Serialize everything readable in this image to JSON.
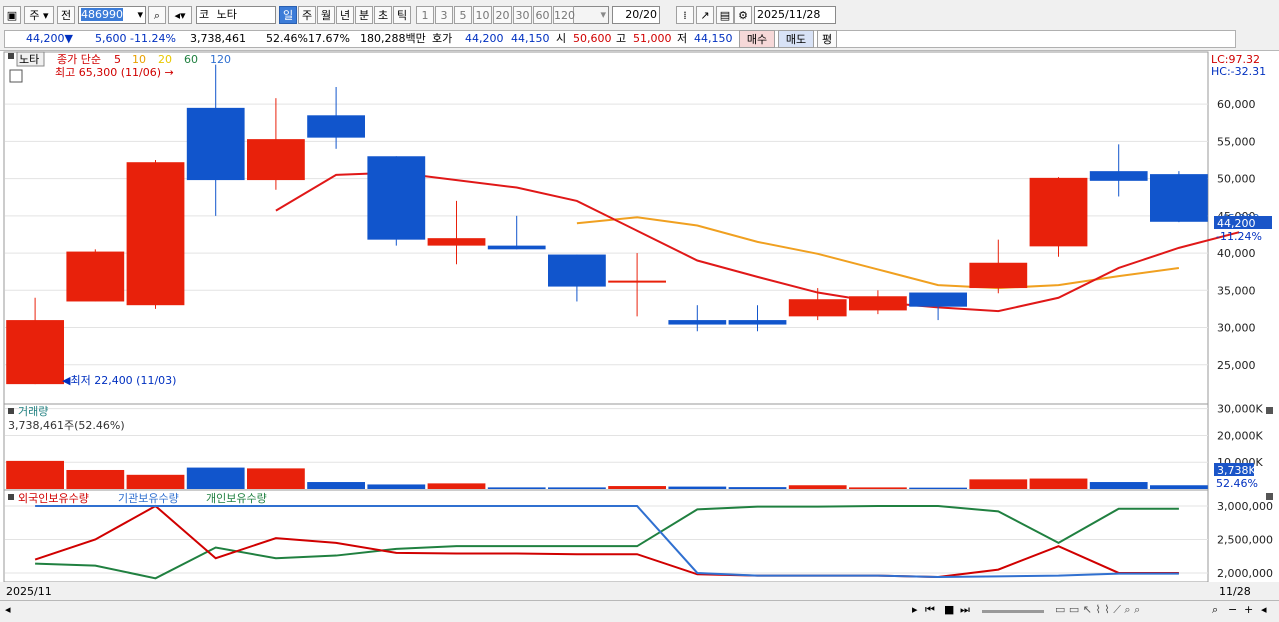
{
  "toolbar": {
    "period": "주",
    "prev_label": "전",
    "code": "486990",
    "market_tag": "코",
    "stock_name": "노타",
    "tabs": [
      "일",
      "주",
      "월",
      "년",
      "분",
      "초",
      "틱"
    ],
    "selected_tab": "일",
    "num_buttons": [
      "1",
      "3",
      "5",
      "10",
      "20",
      "30",
      "60",
      "120"
    ],
    "count_value": "20",
    "count_total": "/20",
    "date": "2025/11/28"
  },
  "quote": {
    "price": "44,200▼",
    "change": "5,600",
    "change_pct": "-11.24%",
    "volume": "3,738,461",
    "turnover_pct": "52.46%",
    "ratio": "17.67%",
    "amount": "180,288백만",
    "hoga_label": "호가",
    "bid": "44,200",
    "ask": "44,150",
    "open_label": "시",
    "open": "50,600",
    "high_label": "고",
    "high": "51,000",
    "low_label": "저",
    "low": "44,150",
    "buy_label": "매수",
    "sell_label": "매도",
    "eval_label": "평"
  },
  "price_panel": {
    "name_tag": "노타",
    "ma_label": "종가 단순",
    "ma_periods": [
      "5",
      "10",
      "20",
      "60",
      "120"
    ],
    "ma_colors": [
      "#d00000",
      "#e8a000",
      "#e8c800",
      "#208040",
      "#3070d0"
    ],
    "high_note": "최고 65,300 (11/06) →",
    "low_note": "◀최저 22,400 (11/03)",
    "lc": "LC:97.32",
    "hc": "HC:-32.31",
    "current_tag": "44,200",
    "current_pct": "-11.24%",
    "ghost_tag": "45,000",
    "axis_ticks": [
      "60,000",
      "55,000",
      "50,000",
      "45,000",
      "40,000",
      "35,000",
      "30,000",
      "25,000"
    ]
  },
  "volume_panel": {
    "title": "거래량",
    "info": "3,738,461주(52.46%)",
    "axis_ticks": [
      "30,000K",
      "20,000K",
      "10,000K"
    ],
    "current_tag": "3,738K",
    "current_pct": "52.46%"
  },
  "holdings_panel": {
    "legend": [
      "외국인보유수량",
      "기관보유수량",
      "개인보유수량"
    ],
    "legend_colors": [
      "#d00000",
      "#3070d0",
      "#208040"
    ],
    "axis_ticks": [
      "3,000,000",
      "2,500,000",
      "2,000,000"
    ]
  },
  "x_axis": {
    "start": "2025/11",
    "end": "11/28"
  },
  "chart_data": {
    "type": "candlestick",
    "up_color": "#e8210b",
    "down_color": "#1155cc",
    "ylim": [
      20000,
      67000
    ],
    "candles": [
      {
        "o": 22400,
        "h": 34000,
        "l": 22400,
        "c": 31000
      },
      {
        "o": 33500,
        "h": 40500,
        "l": 33500,
        "c": 40200
      },
      {
        "o": 33000,
        "h": 52500,
        "l": 32500,
        "c": 52200
      },
      {
        "o": 59500,
        "h": 65300,
        "l": 45000,
        "c": 49800
      },
      {
        "o": 49800,
        "h": 60800,
        "l": 48500,
        "c": 55300
      },
      {
        "o": 58500,
        "h": 62300,
        "l": 54000,
        "c": 55500
      },
      {
        "o": 53000,
        "h": 53000,
        "l": 41000,
        "c": 41800
      },
      {
        "o": 41000,
        "h": 47000,
        "l": 38500,
        "c": 42000
      },
      {
        "o": 41000,
        "h": 45000,
        "l": 40500,
        "c": 40500
      },
      {
        "o": 39800,
        "h": 39800,
        "l": 33500,
        "c": 35500
      },
      {
        "o": 36200,
        "h": 40000,
        "l": 31500,
        "c": 36300
      },
      {
        "o": 31000,
        "h": 33000,
        "l": 29500,
        "c": 30400
      },
      {
        "o": 31000,
        "h": 33000,
        "l": 29500,
        "c": 30400
      },
      {
        "o": 31500,
        "h": 35300,
        "l": 31000,
        "c": 33800
      },
      {
        "o": 32300,
        "h": 35000,
        "l": 31800,
        "c": 34200
      },
      {
        "o": 34700,
        "h": 34700,
        "l": 31000,
        "c": 32800
      },
      {
        "o": 35300,
        "h": 41800,
        "l": 34600,
        "c": 38700
      },
      {
        "o": 40900,
        "h": 50200,
        "l": 39500,
        "c": 50100
      },
      {
        "o": 51000,
        "h": 54600,
        "l": 47600,
        "c": 49700
      },
      {
        "o": 50600,
        "h": 51000,
        "l": 44150,
        "c": 44200
      }
    ],
    "ma5": [
      null,
      null,
      null,
      null,
      45700,
      50500,
      50800,
      null,
      48800,
      47000,
      43000,
      39000,
      36800,
      34700,
      33400,
      32700,
      32200,
      34000,
      38000,
      40700,
      42800
    ],
    "ma20": [
      null,
      null,
      null,
      null,
      null,
      null,
      null,
      null,
      null,
      44000,
      44800,
      43700,
      41500,
      39900,
      37800,
      35700,
      35300,
      35700,
      36900,
      38000
    ],
    "volume": [
      10500,
      7100,
      5300,
      8000,
      7700,
      2600,
      1700,
      2100,
      600,
      600,
      1100,
      900,
      700,
      1400,
      600,
      500,
      3600,
      3900,
      2600,
      1400
    ],
    "foreign": [
      2200000,
      2500000,
      3000000,
      2220000,
      2520000,
      2450000,
      2300000,
      2290000,
      2290000,
      2280000,
      2280000,
      1980000,
      1960000,
      1960000,
      1960000,
      1940000,
      2050000,
      2400000,
      2000000,
      2000000
    ],
    "institution": [
      3000000,
      3000000,
      3000000,
      3000000,
      3000000,
      3000000,
      3000000,
      3000000,
      3000000,
      3000000,
      3000000,
      2000000,
      1960000,
      1960000,
      1960000,
      1940000,
      1950000,
      1960000,
      1990000,
      1990000
    ],
    "individual": [
      2140000,
      2110000,
      1920000,
      2380000,
      2220000,
      2260000,
      2360000,
      2400000,
      2400000,
      2400000,
      2400000,
      2950000,
      2990000,
      2990000,
      3000000,
      3000000,
      2920000,
      2450000,
      2960000,
      2960000
    ]
  }
}
